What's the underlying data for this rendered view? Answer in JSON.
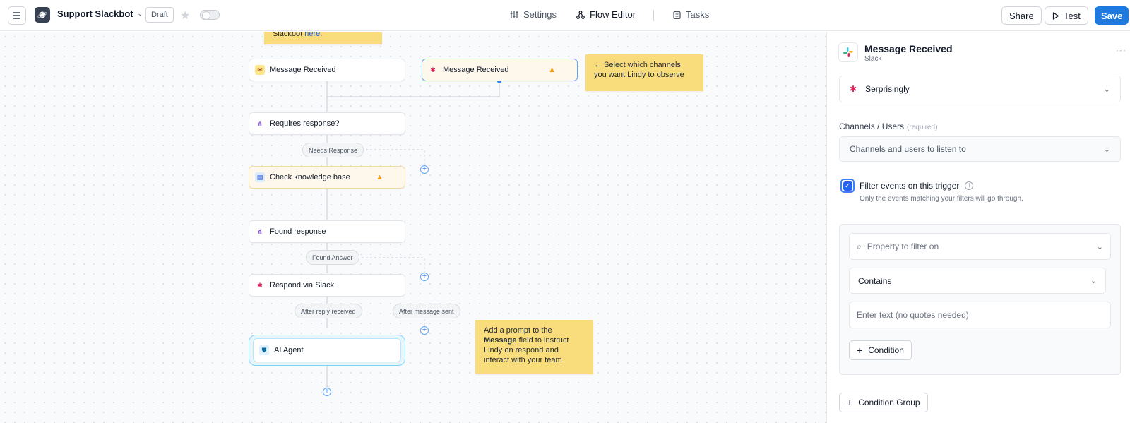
{
  "header": {
    "app_name": "Support Slackbot",
    "status_badge": "Draft",
    "nav": {
      "settings": "Settings",
      "flow_editor": "Flow Editor",
      "tasks": "Tasks"
    },
    "share_label": "Share",
    "test_label": "Test",
    "save_label": "Save"
  },
  "canvas": {
    "top_note_text": "Slackbot ",
    "top_note_link": "here",
    "top_note_end": ".",
    "nodes": {
      "trigger_left": "Message Received",
      "trigger_right": "Message Received",
      "requires_response": "Requires response?",
      "check_kb": "Check knowledge base",
      "found_response": "Found response",
      "respond_slack": "Respond via Slack",
      "ai_agent": "AI Agent"
    },
    "pills": {
      "needs_response": "Needs Response",
      "found_answer": "Found Answer",
      "after_reply": "After reply received",
      "after_message": "After message sent"
    },
    "note_channels": "← Select which channels you want Lindy to observe",
    "note_prompt": {
      "before": "Add a prompt to the ",
      "bold": "Message",
      "after": " field to instruct Lindy on respond and interact with your team"
    }
  },
  "panel": {
    "title": "Message Received",
    "subtitle": "Slack",
    "account_select": "Serprisingly",
    "channels_label": "Channels / Users",
    "channels_required": "(required)",
    "channels_placeholder": "Channels and users to listen to",
    "filter_label": "Filter events on this trigger",
    "filter_help": "Only the events matching your filters will go through.",
    "filter_checked": true,
    "property_placeholder": "Property to filter on",
    "operator_value": "Contains",
    "text_placeholder": "Enter text (no quotes needed)",
    "condition_label": "Condition",
    "condition_group_label": "Condition Group"
  },
  "colors": {
    "accent": "#1f7ae0",
    "note": "#f9dd7c",
    "warning": "#f59e0b",
    "selected_border": "#60a5fa"
  }
}
